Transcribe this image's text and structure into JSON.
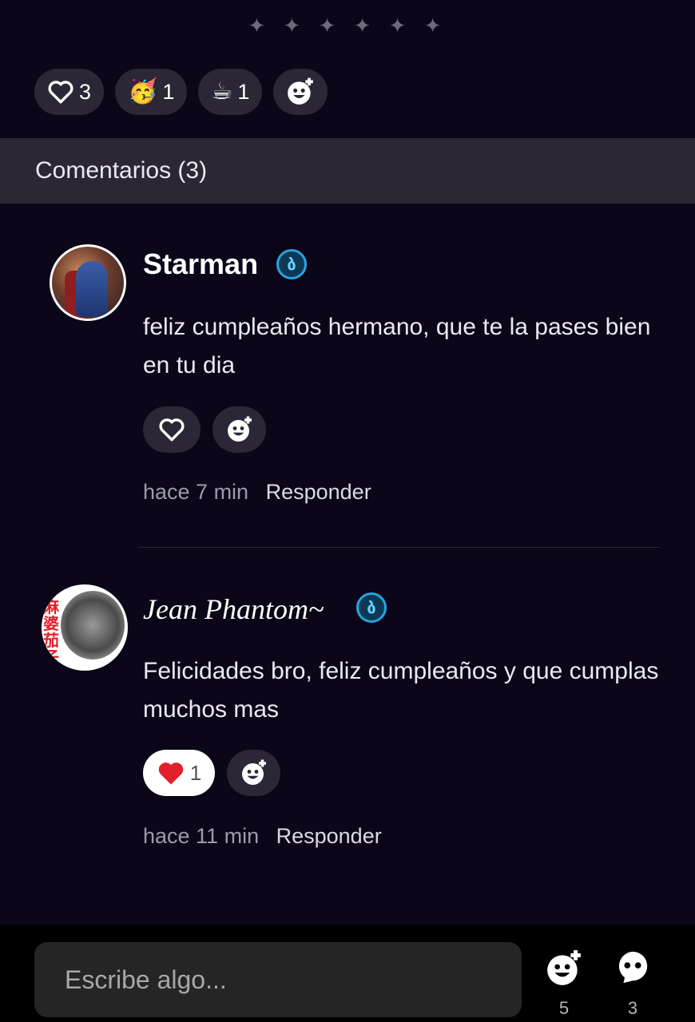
{
  "decor": {
    "stars": "✦ ✦ ✦ ✦ ✦ ✦"
  },
  "reactions": [
    {
      "icon": "heart-outline-icon",
      "count": "3"
    },
    {
      "icon": "party-face-emoji",
      "emoji": "🥳",
      "count": "1"
    },
    {
      "icon": "coffee-cup-emoji",
      "emoji": "☕",
      "count": "1"
    },
    {
      "icon": "add-reaction-icon"
    }
  ],
  "comments_header": {
    "title": "Comentarios (3)"
  },
  "comments": [
    {
      "author": "Starman",
      "badge": "ბ",
      "text": "feliz cumpleaños hermano, que te la pases bien en tu dia",
      "time": "hace 7 min",
      "reply": "Responder",
      "liked": false
    },
    {
      "author": "Jean Phantom~",
      "badge": "ბ",
      "avatar_text": "麻婆茄子",
      "text": "Felicidades bro, feliz cumpleaños y que cumplas muchos mas",
      "time": "hace 11 min",
      "reply": "Responder",
      "liked": true,
      "like_count": "1"
    }
  ],
  "composer": {
    "placeholder": "Escribe algo..."
  },
  "bottom_actions": [
    {
      "icon": "add-reaction-icon",
      "count": "5"
    },
    {
      "icon": "ghost-icon",
      "count": "3"
    }
  ],
  "colors": {
    "background": "#0b0618",
    "pill": "#2b2736",
    "header_bar": "#2b2735",
    "badge": "#2aa3e0",
    "like_red": "#e0202a"
  }
}
